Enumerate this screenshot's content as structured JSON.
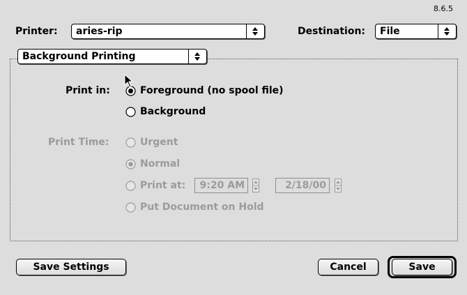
{
  "version": "8.6.5",
  "printer": {
    "label": "Printer:",
    "value": "aries-rip"
  },
  "destination": {
    "label": "Destination:",
    "value": "File"
  },
  "section_popup": {
    "value": "Background Printing"
  },
  "print_in": {
    "label": "Print in:",
    "options": [
      {
        "label": "Foreground (no spool file)",
        "selected": true
      },
      {
        "label": "Background",
        "selected": false
      }
    ]
  },
  "print_time": {
    "label": "Print Time:",
    "options": [
      {
        "label": "Urgent",
        "selected": false
      },
      {
        "label": "Normal",
        "selected": true
      },
      {
        "label": "Print at:",
        "selected": false
      },
      {
        "label": "Put Document on Hold",
        "selected": false
      }
    ],
    "time": "9:20 AM",
    "date": "2/18/00"
  },
  "buttons": {
    "save_settings": "Save Settings",
    "cancel": "Cancel",
    "save": "Save"
  },
  "colors": {
    "background": "#dddddd",
    "disabled_text": "#9b9b9b"
  }
}
